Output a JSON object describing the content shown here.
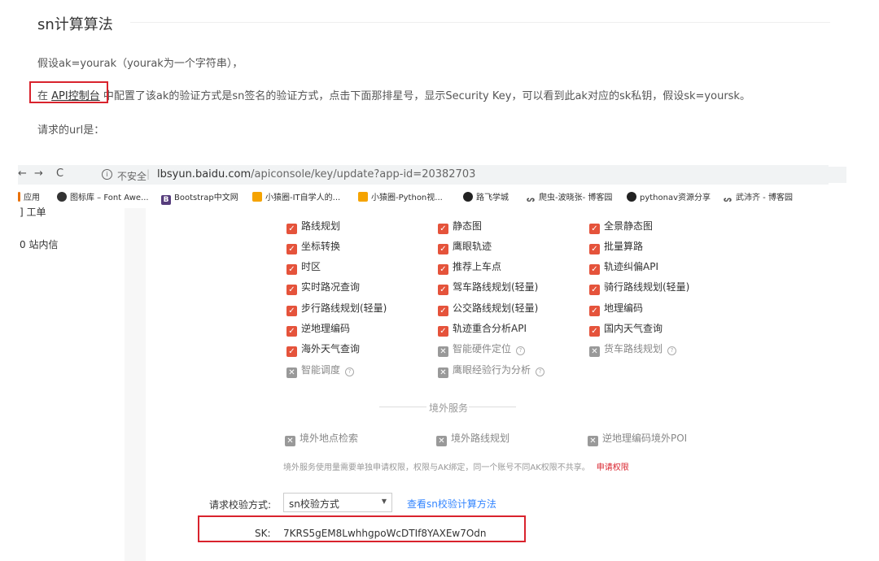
{
  "doc": {
    "title": "sn计算算法",
    "para1": "假设ak=yourak（yourak为一个字符串），",
    "para2_prefix": "在 ",
    "para2_link": "API控制台",
    "para2_suffix": " 中配置了该ak的验证方式是sn签名的验证方式，点击下面那排星号，显示Security Key，可以看到此ak对应的sk私钥，假设sk=yoursk。",
    "para3": "请求的url是："
  },
  "browser": {
    "back": "←",
    "forward": "→",
    "reload": "C",
    "insecure_label": "不安全",
    "url_host": "lbsyun.baidu.com",
    "url_path": "/apiconsole/key/update?app-id=20382703",
    "bookmarks": [
      {
        "label": "应用",
        "icon": "apps-icon",
        "color": "#e8710a"
      },
      {
        "label": "图标库 – Font Awe...",
        "icon": "globe-icon",
        "color": "#333333"
      },
      {
        "label": "Bootstrap中文网",
        "icon": "bootstrap-icon",
        "color": "#563d7c"
      },
      {
        "label": "小猿圈-IT自学人的...",
        "icon": "xiaoyuan-icon",
        "color": "#f5a300"
      },
      {
        "label": "小猿圈-Python视...",
        "icon": "xiaoyuan-icon",
        "color": "#f5a300"
      },
      {
        "label": "路飞学城",
        "icon": "luffy-icon",
        "color": "#222222"
      },
      {
        "label": "爬虫-波晓张- 博客园",
        "icon": "cnblogs-icon",
        "color": "#555555"
      },
      {
        "label": "pythonav资源分享",
        "icon": "luffy-icon",
        "color": "#222222"
      },
      {
        "label": "武沛齐 - 博客园",
        "icon": "cnblogs-icon",
        "color": "#555555"
      }
    ]
  },
  "sidebar": {
    "item1": "工单",
    "item2": "站内信"
  },
  "services": [
    {
      "label": "路线规划",
      "checked": true
    },
    {
      "label": "静态图",
      "checked": true
    },
    {
      "label": "全景静态图",
      "checked": true
    },
    {
      "label": "坐标转换",
      "checked": true
    },
    {
      "label": "鹰眼轨迹",
      "checked": true
    },
    {
      "label": "批量算路",
      "checked": true
    },
    {
      "label": "时区",
      "checked": true
    },
    {
      "label": "推荐上车点",
      "checked": true
    },
    {
      "label": "轨迹纠偏API",
      "checked": true
    },
    {
      "label": "实时路况查询",
      "checked": true
    },
    {
      "label": "驾车路线规划(轻量)",
      "checked": true
    },
    {
      "label": "骑行路线规划(轻量)",
      "checked": true
    },
    {
      "label": "步行路线规划(轻量)",
      "checked": true
    },
    {
      "label": "公交路线规划(轻量)",
      "checked": true
    },
    {
      "label": "地理编码",
      "checked": true
    },
    {
      "label": "逆地理编码",
      "checked": true
    },
    {
      "label": "轨迹重合分析API",
      "checked": true
    },
    {
      "label": "国内天气查询",
      "checked": true
    },
    {
      "label": "海外天气查询",
      "checked": true
    },
    {
      "label": "智能硬件定位",
      "checked": false,
      "help": true
    },
    {
      "label": "货车路线规划",
      "checked": false,
      "help": true
    },
    {
      "label": "智能调度",
      "checked": false,
      "help": true
    },
    {
      "label": "鹰眼经验行为分析",
      "checked": false,
      "help": true
    }
  ],
  "overseas": {
    "section_label": "境外服务",
    "items": [
      {
        "label": "境外地点检索",
        "checked": false
      },
      {
        "label": "境外路线规划",
        "checked": false
      },
      {
        "label": "逆地理编码境外POI",
        "checked": false
      }
    ],
    "notice": "境外服务使用量需要单独申请权限，权限与AK绑定，同一个账号不同AK权限不共享。",
    "notice_link": "申请权限"
  },
  "verify": {
    "label": "请求校验方式:",
    "selected": "sn校验方式",
    "calc_link": "查看sn校验计算方法",
    "sk_label": "SK:",
    "sk_value": "7KRS5gEM8LwhhgpoWcDTIf8YAXEw7Odn"
  },
  "colors": {
    "checked": "#e5533b",
    "highlight_border": "#d9232d",
    "link": "#3385ff"
  }
}
